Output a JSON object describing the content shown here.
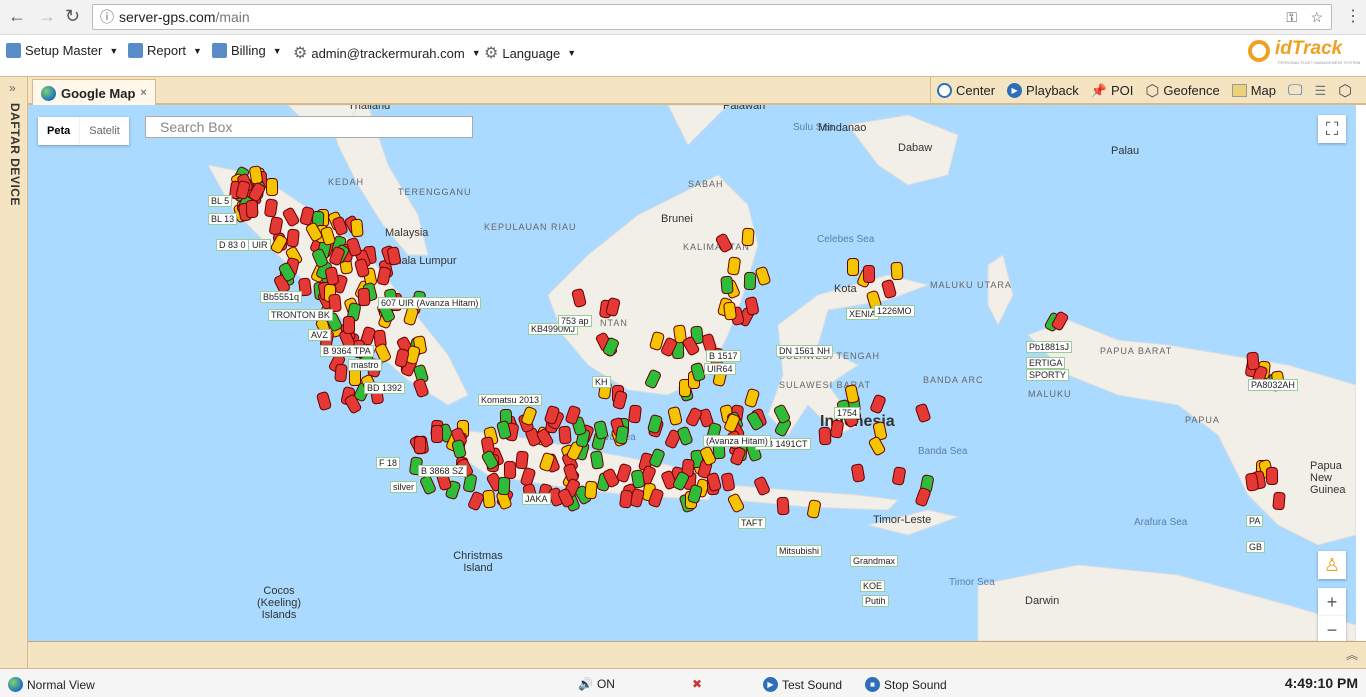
{
  "browser": {
    "url_host": "server-gps.com",
    "url_path": "/main"
  },
  "menu": [
    {
      "label": "Setup Master"
    },
    {
      "label": "Report"
    },
    {
      "label": "Billing"
    },
    {
      "label": "admin@trackermurah.com"
    },
    {
      "label": "Language"
    }
  ],
  "logo": {
    "text": "idTrack",
    "tagline": "PERSONAL FLEET MANAGEMENT SYSTEM"
  },
  "sidebar": {
    "label": "DAFTAR DEVICE"
  },
  "tab": {
    "label": "Google Map",
    "close": "×"
  },
  "toolbar": {
    "center": "Center",
    "playback": "Playback",
    "poi": "POI",
    "geofence": "Geofence",
    "map": "Map"
  },
  "map": {
    "type_buttons": [
      "Peta",
      "Satelit"
    ],
    "search_placeholder": "Search Box",
    "labels": [
      "Thailand",
      "Palawan",
      "Sulu Sea",
      "Mindanao",
      "Dabaw",
      "Palau",
      "SABAH",
      "Brunei",
      "KEDAH",
      "TERENGGANU",
      "Malaysia",
      "Kuala Lumpur",
      "KEPULAUAN RIAU",
      "Celebes Sea",
      "KALIMANTAN",
      "Kota",
      "MALUKU UTARA",
      "SULAWESI TENGAH",
      "SULAWESI BARAT",
      "Java Sea",
      "Banda Sea",
      "BANDA ARC",
      "PAPUA BARAT",
      "PAPUA",
      "MALUKU",
      "Indonesia",
      "Timor-Leste",
      "Timor Sea",
      "Arafura Sea",
      "Papua New Guinea",
      "Christmas Island",
      "Cocos (Keeling) Islands",
      "Darwin",
      "NTAN"
    ],
    "vehicles": [
      "BL 5",
      "BL 13",
      "B 1423 UIR",
      "D 83 0",
      "Bb5551q",
      "TRONTON BK",
      "AVZ",
      "B 9364 TPA",
      "mastro",
      "BD 1392",
      "F 18",
      "silver",
      "B 3868 SZ",
      "KB4990MJ",
      "753 ap",
      "Komatsu 2013",
      "607 UIR (Avanza Hitam)",
      "XENIA",
      "1226MO",
      "Pb1881sJ",
      "ERTIGA",
      "SPORTY",
      "PA8032AH",
      "D B 1491CT",
      "Grandmax",
      "KOE",
      "Putih",
      "Mitsubishi",
      "TAFT",
      "B 1517",
      "DN 1561 NH",
      "1754",
      "(Avanza Hitam)",
      "KH",
      "UIR64",
      "JAKA",
      "GB",
      "PA"
    ],
    "colors": {
      "sea": "#aadaff",
      "land": "#f2efe9",
      "car_red": "#e53935",
      "car_yellow": "#f5c400",
      "car_green": "#2ebd3a"
    }
  },
  "status": {
    "view": "Normal View",
    "sound": "ON",
    "test_sound": "Test Sound",
    "stop_sound": "Stop Sound",
    "time": "4:49:10 PM"
  }
}
